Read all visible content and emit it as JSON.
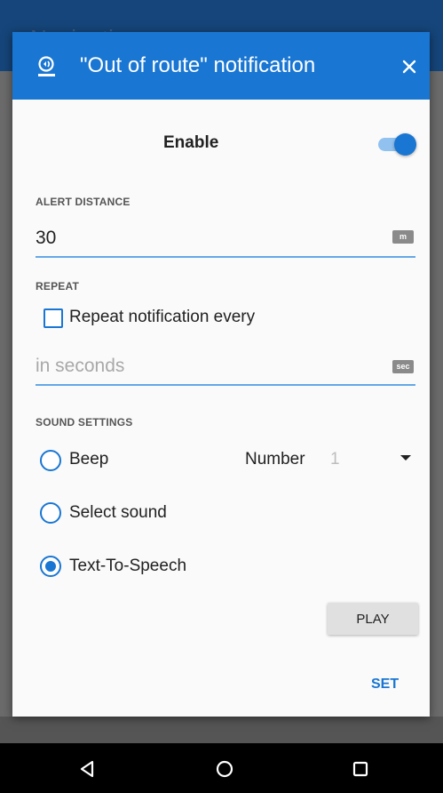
{
  "background": {
    "app_title_fragment": "Navigation"
  },
  "dialog": {
    "title": "\"Out of route\" notification",
    "header_icon": "speaker-alert-icon",
    "close_icon": "close-icon",
    "enable": {
      "label": "Enable",
      "on": true
    },
    "alert_distance": {
      "section_label": "ALERT DISTANCE",
      "value": "30",
      "unit": "m"
    },
    "repeat": {
      "section_label": "REPEAT",
      "checkbox_label": "Repeat notification every",
      "checked": false,
      "placeholder": "in seconds",
      "unit": "sec"
    },
    "sound_settings": {
      "section_label": "SOUND SETTINGS",
      "options": [
        {
          "label": "Beep",
          "selected": false
        },
        {
          "label": "Select sound",
          "selected": false
        },
        {
          "label": "Text-To-Speech",
          "selected": true
        }
      ],
      "number_label": "Number",
      "number_value": "1"
    },
    "play_button": "PLAY",
    "set_button": "SET"
  },
  "navbar": {
    "icons": [
      "back-icon",
      "home-icon",
      "recents-icon"
    ]
  },
  "colors": {
    "accent": "#1976d2",
    "header": "#1976d2",
    "navbar": "#000000"
  }
}
